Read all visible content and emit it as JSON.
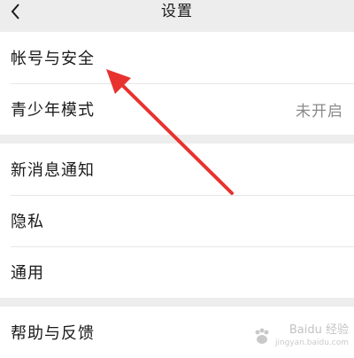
{
  "header": {
    "title": "设置",
    "back_icon": "chevron-left-icon"
  },
  "groups": [
    {
      "items": [
        {
          "label": "帐号与安全"
        },
        {
          "label": "青少年模式",
          "value": "未开启"
        }
      ]
    },
    {
      "items": [
        {
          "label": "新消息通知"
        },
        {
          "label": "隐私"
        },
        {
          "label": "通用"
        }
      ]
    },
    {
      "items": [
        {
          "label": "帮助与反馈"
        }
      ]
    }
  ],
  "annotation": {
    "type": "arrow",
    "color": "#e8322f",
    "points_to": "帐号与安全"
  },
  "watermark": {
    "brand": "Baidu 经验",
    "url": "jingyan.baidu.com"
  },
  "colors": {
    "background": "#ededed",
    "card": "#ffffff",
    "secondary_text": "#8a8a8a"
  }
}
